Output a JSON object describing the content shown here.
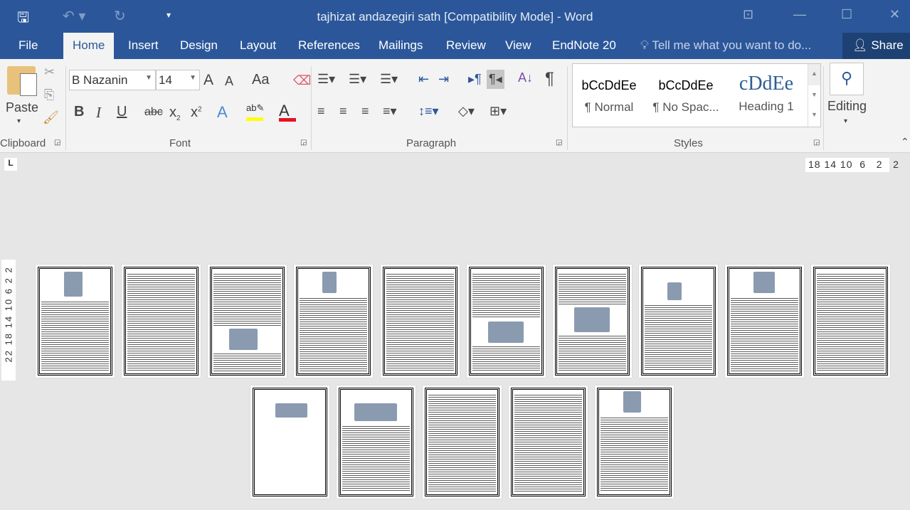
{
  "window": {
    "title": "tajhizat andazegiri sath [Compatibility Mode] - Word"
  },
  "quick_access": {
    "save_icon": "floppy-disk-icon",
    "undo_icon": "undo-icon",
    "redo_icon": "redo-icon",
    "customize_icon": "customize-icon"
  },
  "tabs": [
    {
      "label": "File"
    },
    {
      "label": "Home",
      "active": true
    },
    {
      "label": "Insert"
    },
    {
      "label": "Design"
    },
    {
      "label": "Layout"
    },
    {
      "label": "References"
    },
    {
      "label": "Mailings"
    },
    {
      "label": "Review"
    },
    {
      "label": "View"
    },
    {
      "label": "EndNote 20"
    }
  ],
  "tell_me": {
    "placeholder": "Tell me what you want to do..."
  },
  "share": {
    "label": "Share"
  },
  "clipboard": {
    "paste": "Paste",
    "group": "Clipboard"
  },
  "font": {
    "name": "B Nazanin",
    "size": "14",
    "group": "Font",
    "grow": "A",
    "shrink": "A",
    "case": "Aa",
    "bold": "B",
    "italic": "I",
    "underline": "U",
    "strike": "abc",
    "sub": "x",
    "super": "x",
    "highlight_color": "#ffff00",
    "font_color": "#e81123"
  },
  "paragraph": {
    "group": "Paragraph",
    "show_marks": "¶"
  },
  "styles": {
    "group": "Styles",
    "items": [
      {
        "sample": "bCcDdEe",
        "name": "¶ Normal"
      },
      {
        "sample": "bCcDdEe",
        "name": "¶ No Spac..."
      },
      {
        "sample": "cDdEe",
        "name": "Heading 1"
      }
    ]
  },
  "editing": {
    "label": "Editing"
  },
  "ruler": {
    "horizontal": "18 14 10  6   2   2",
    "vertical": "22 18 14 10 6 2 2",
    "tab_selector": "L"
  },
  "accent": "#2b579a",
  "pages_count": 15
}
